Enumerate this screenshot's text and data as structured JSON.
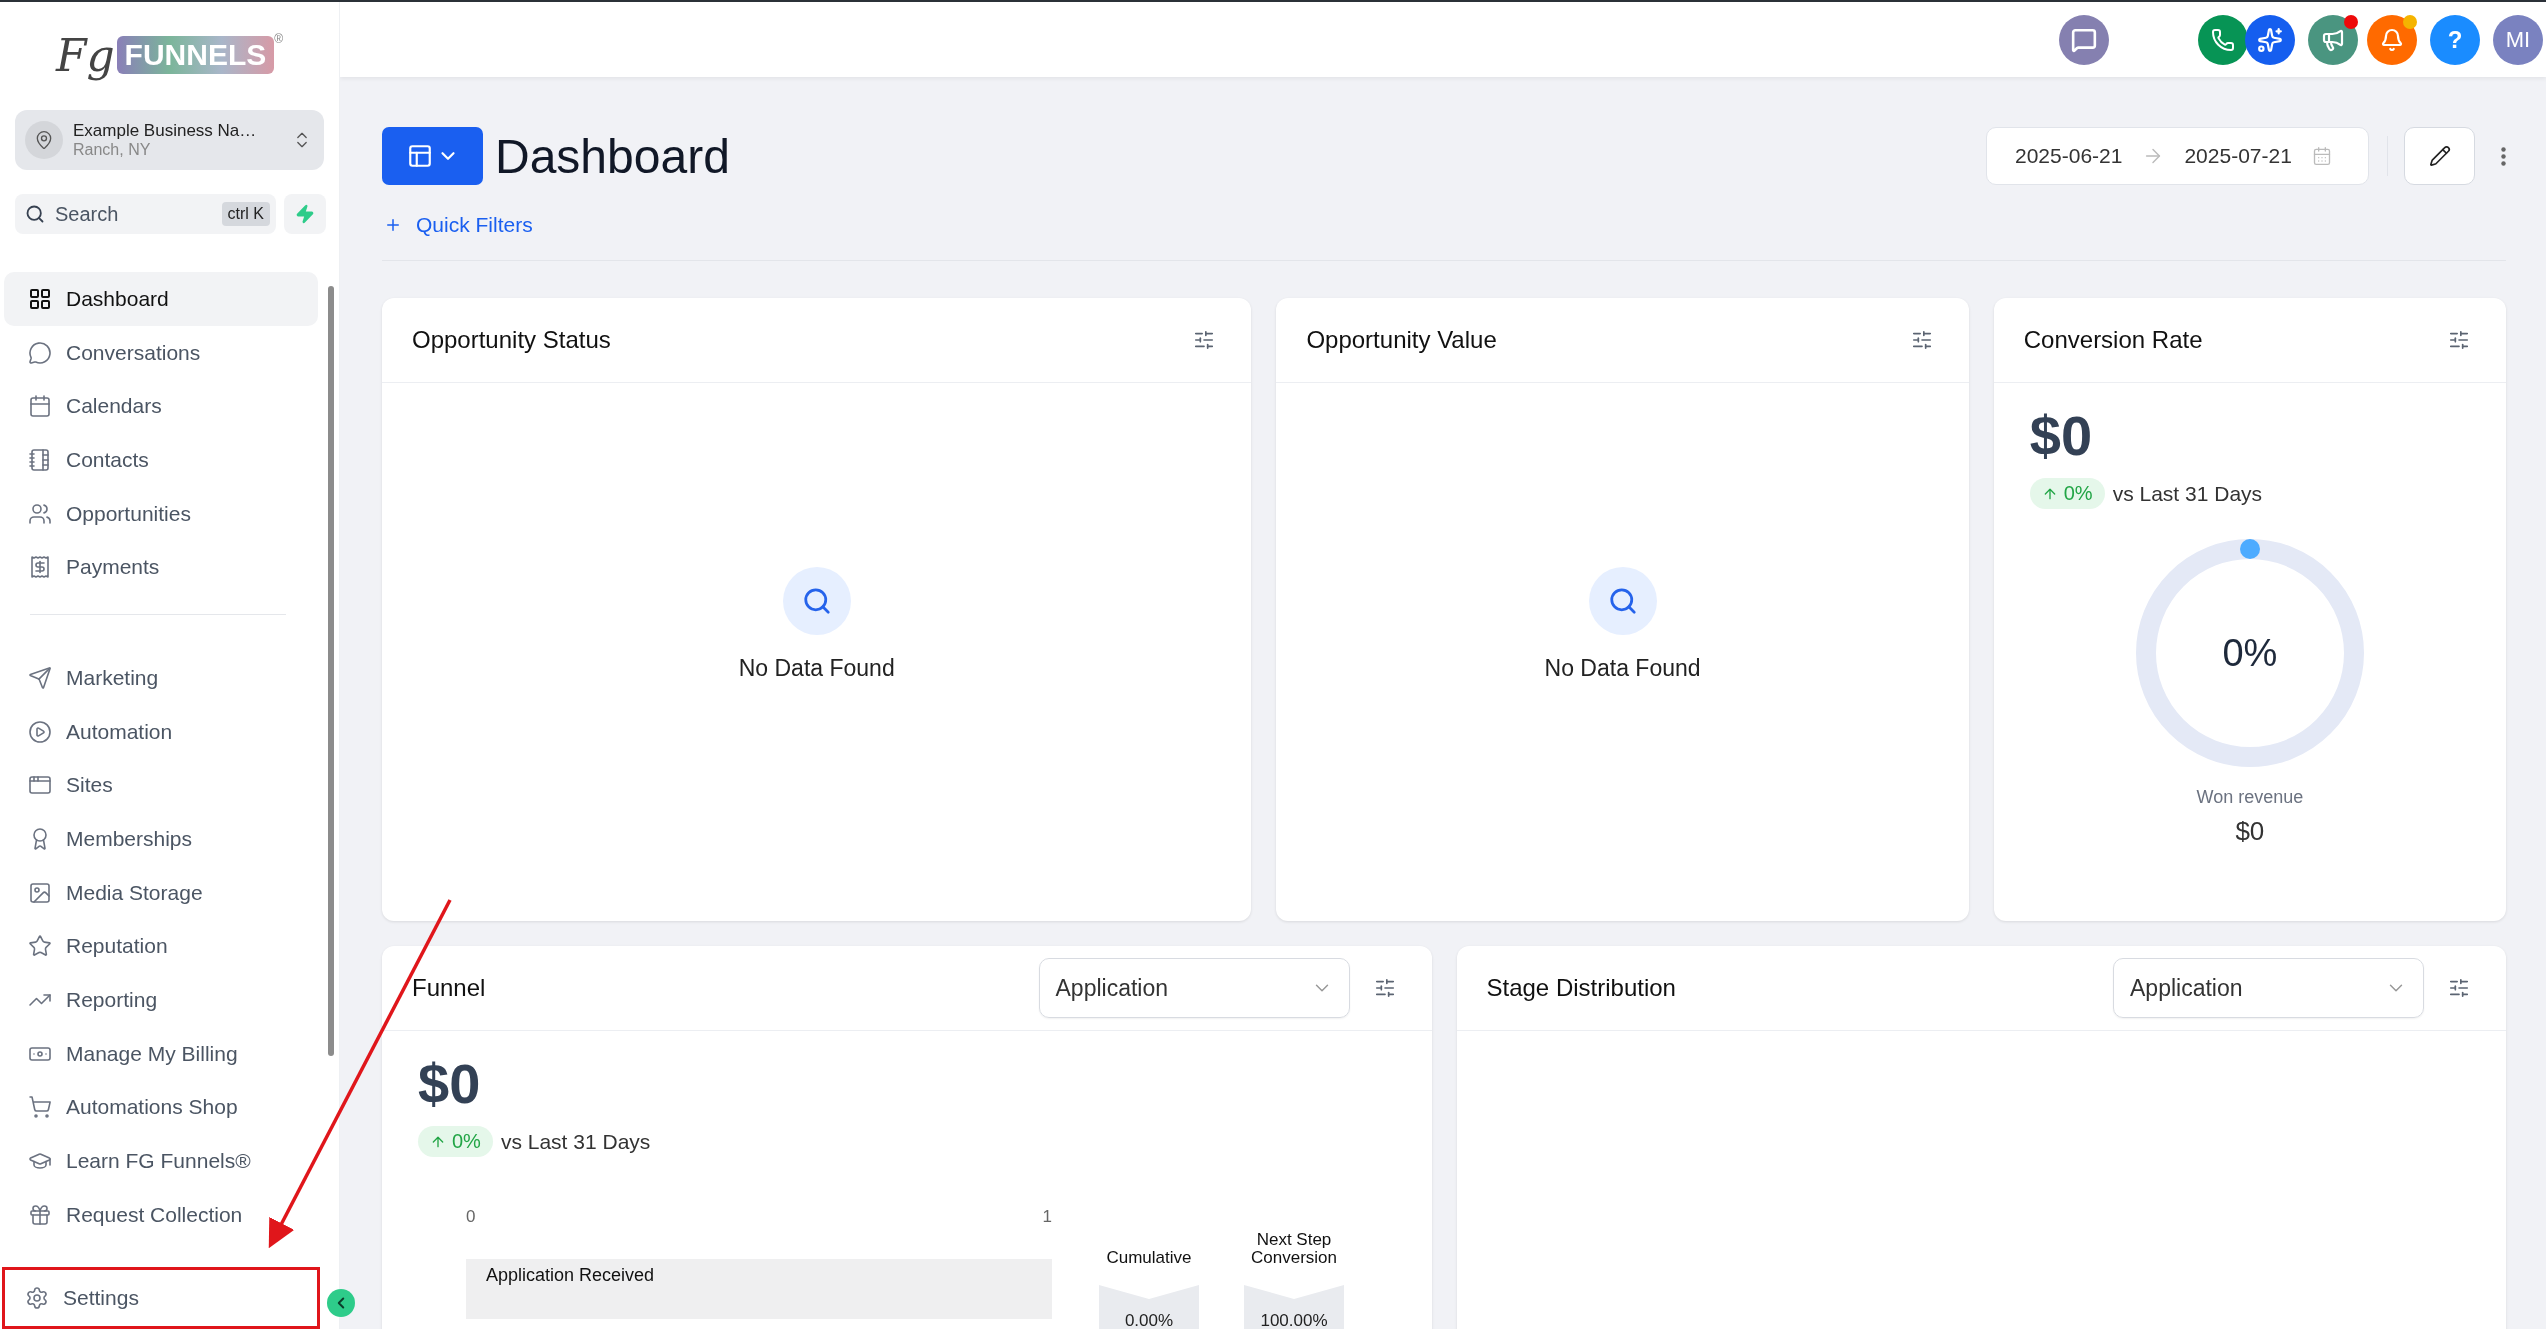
{
  "logo": {
    "mark": "Fg",
    "word": "FUNNELS",
    "reg": "®"
  },
  "account": {
    "name": "Example Business Na…",
    "location": "Ranch, NY"
  },
  "search": {
    "placeholder": "Search",
    "shortcut": "ctrl K"
  },
  "nav_groups": [
    [
      {
        "label": "Dashboard",
        "selected": true
      },
      {
        "label": "Conversations",
        "selected": false
      },
      {
        "label": "Calendars",
        "selected": false
      },
      {
        "label": "Contacts",
        "selected": false
      },
      {
        "label": "Opportunities",
        "selected": false
      },
      {
        "label": "Payments",
        "selected": false
      }
    ],
    [
      {
        "label": "Marketing",
        "selected": false
      },
      {
        "label": "Automation",
        "selected": false
      },
      {
        "label": "Sites",
        "selected": false
      },
      {
        "label": "Memberships",
        "selected": false
      },
      {
        "label": "Media Storage",
        "selected": false
      },
      {
        "label": "Reputation",
        "selected": false
      },
      {
        "label": "Reporting",
        "selected": false
      },
      {
        "label": "Manage My Billing",
        "selected": false
      },
      {
        "label": "Automations Shop",
        "selected": false
      },
      {
        "label": "Learn FG Funnels®",
        "selected": false
      },
      {
        "label": "Request Collection",
        "selected": false
      }
    ]
  ],
  "settings": {
    "label": "Settings",
    "selected": false,
    "highlighted": true
  },
  "top_actions": [
    {
      "kind": "chat"
    },
    {
      "kind": "phone"
    },
    {
      "kind": "ai"
    },
    {
      "kind": "announce",
      "color": "#ee0a0a"
    },
    {
      "kind": "bell",
      "color": "#f5b400"
    },
    {
      "kind": "help",
      "label": "?"
    },
    {
      "kind": "avatar",
      "label": "MI"
    }
  ],
  "header": {
    "title": "Dashboard",
    "quick_filters": "Quick Filters",
    "date_from": "2025-06-21",
    "date_to": "2025-07-21"
  },
  "top_cards": [
    {
      "kind": "empty",
      "title": "Opportunity Status",
      "message": "No Data Found"
    },
    {
      "kind": "empty",
      "title": "Opportunity Value",
      "message": "No Data Found"
    },
    {
      "kind": "rate",
      "title": "Conversion Rate",
      "value": "$0",
      "change": "0%",
      "compare": "vs Last 31 Days",
      "gauge_label": "0%",
      "caption": "Won revenue",
      "caption_value": "$0"
    }
  ],
  "bottom_cards": [
    {
      "kind": "funnel",
      "title": "Funnel",
      "select": "Application",
      "value": "$0",
      "change": "0%",
      "compare": "vs Last 31 Days",
      "axis": [
        "0",
        "1"
      ],
      "columns": [
        "Cumulative",
        "Next Step Conversion"
      ],
      "stages": [
        {
          "label": "Application Received",
          "cumulative": "0.00%",
          "next": "100.00%"
        }
      ]
    },
    {
      "kind": "stage",
      "title": "Stage Distribution",
      "select": "Application"
    }
  ]
}
